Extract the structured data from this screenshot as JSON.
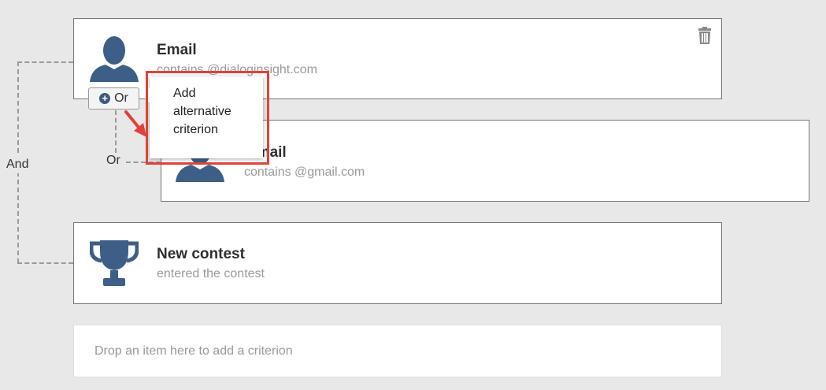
{
  "criteria": [
    {
      "title": "Email",
      "subtitle": "contains @dialoginsight.com"
    },
    {
      "title": "Email",
      "subtitle": "contains @gmail.com"
    },
    {
      "title": "New contest",
      "subtitle": "entered the contest"
    }
  ],
  "connectors": {
    "and_label": "And",
    "or_label": "Or"
  },
  "or_button": {
    "label": "Or"
  },
  "tooltip": {
    "line1": "Add",
    "line2": "alternative",
    "line3": "criterion"
  },
  "dropzone": {
    "label": "Drop an item here to add a criterion"
  },
  "colors": {
    "icon": "#3d5f87",
    "highlight": "#e0413b"
  },
  "icons": [
    "person-icon",
    "trophy-icon",
    "trash-icon",
    "plus-circle-icon",
    "arrow-icon"
  ]
}
